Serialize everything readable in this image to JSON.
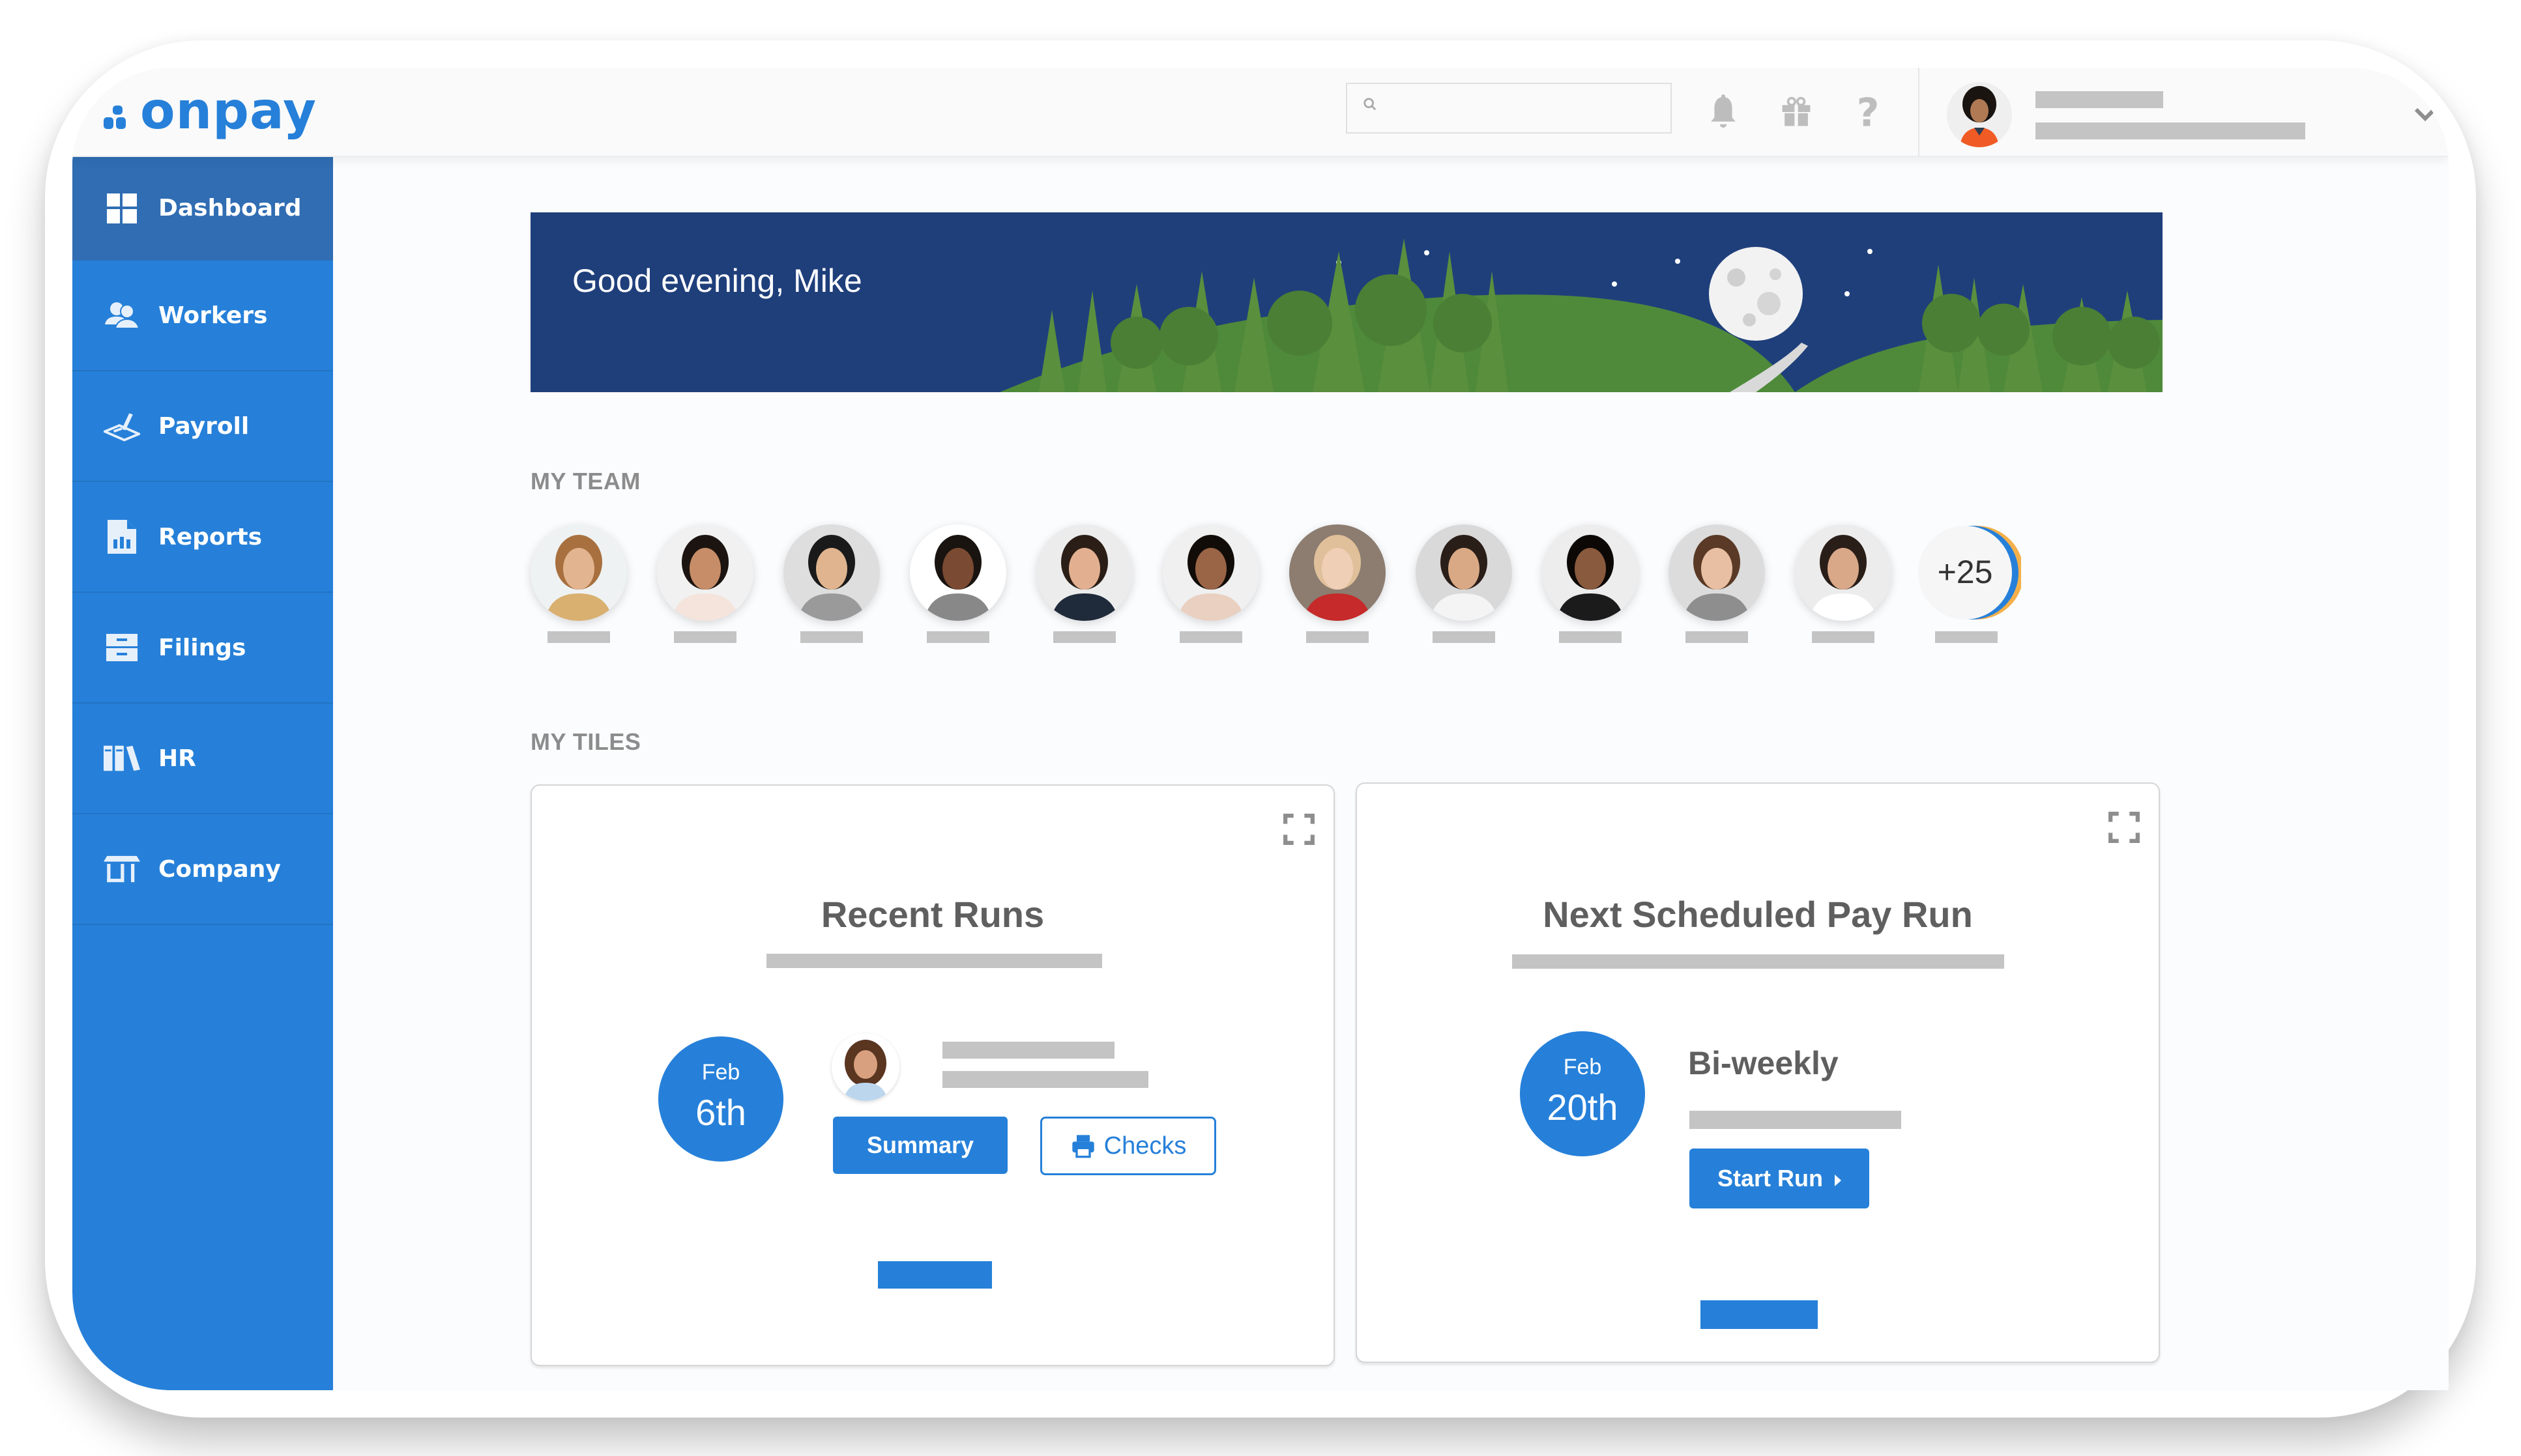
{
  "header": {
    "logo_text": "onpay",
    "search": {
      "placeholder": "",
      "value": ""
    },
    "icons": [
      "search-icon",
      "bell-icon",
      "gift-icon",
      "help-icon",
      "chevron-down-icon"
    ]
  },
  "sidebar": {
    "items": [
      {
        "label": "Dashboard",
        "icon": "dashboard-icon",
        "active": true
      },
      {
        "label": "Workers",
        "icon": "workers-icon",
        "active": false
      },
      {
        "label": "Payroll",
        "icon": "payroll-icon",
        "active": false
      },
      {
        "label": "Reports",
        "icon": "reports-icon",
        "active": false
      },
      {
        "label": "Filings",
        "icon": "filings-icon",
        "active": false
      },
      {
        "label": "HR",
        "icon": "hr-icon",
        "active": false
      },
      {
        "label": "Company",
        "icon": "company-icon",
        "active": false
      }
    ]
  },
  "banner": {
    "greeting": "Good evening, Mike"
  },
  "team": {
    "label": "MY TEAM",
    "member_count_shown": 11,
    "more_count": "+25"
  },
  "tiles": {
    "label": "MY TILES",
    "recent_runs": {
      "title": "Recent Runs",
      "month": "Feb",
      "day": "6th",
      "summary_label": "Summary",
      "checks_label": "Checks"
    },
    "next_pay_run": {
      "title": "Next Scheduled Pay Run",
      "month": "Feb",
      "day": "20th",
      "frequency": "Bi-weekly",
      "start_label": "Start Run"
    }
  },
  "colors": {
    "brand_blue": "#2680d9",
    "sidebar_active": "#306db3",
    "banner_navy": "#1f3f7b",
    "placeholder_gray": "#c4c4c4",
    "accent_orange": "#f5b04a"
  }
}
